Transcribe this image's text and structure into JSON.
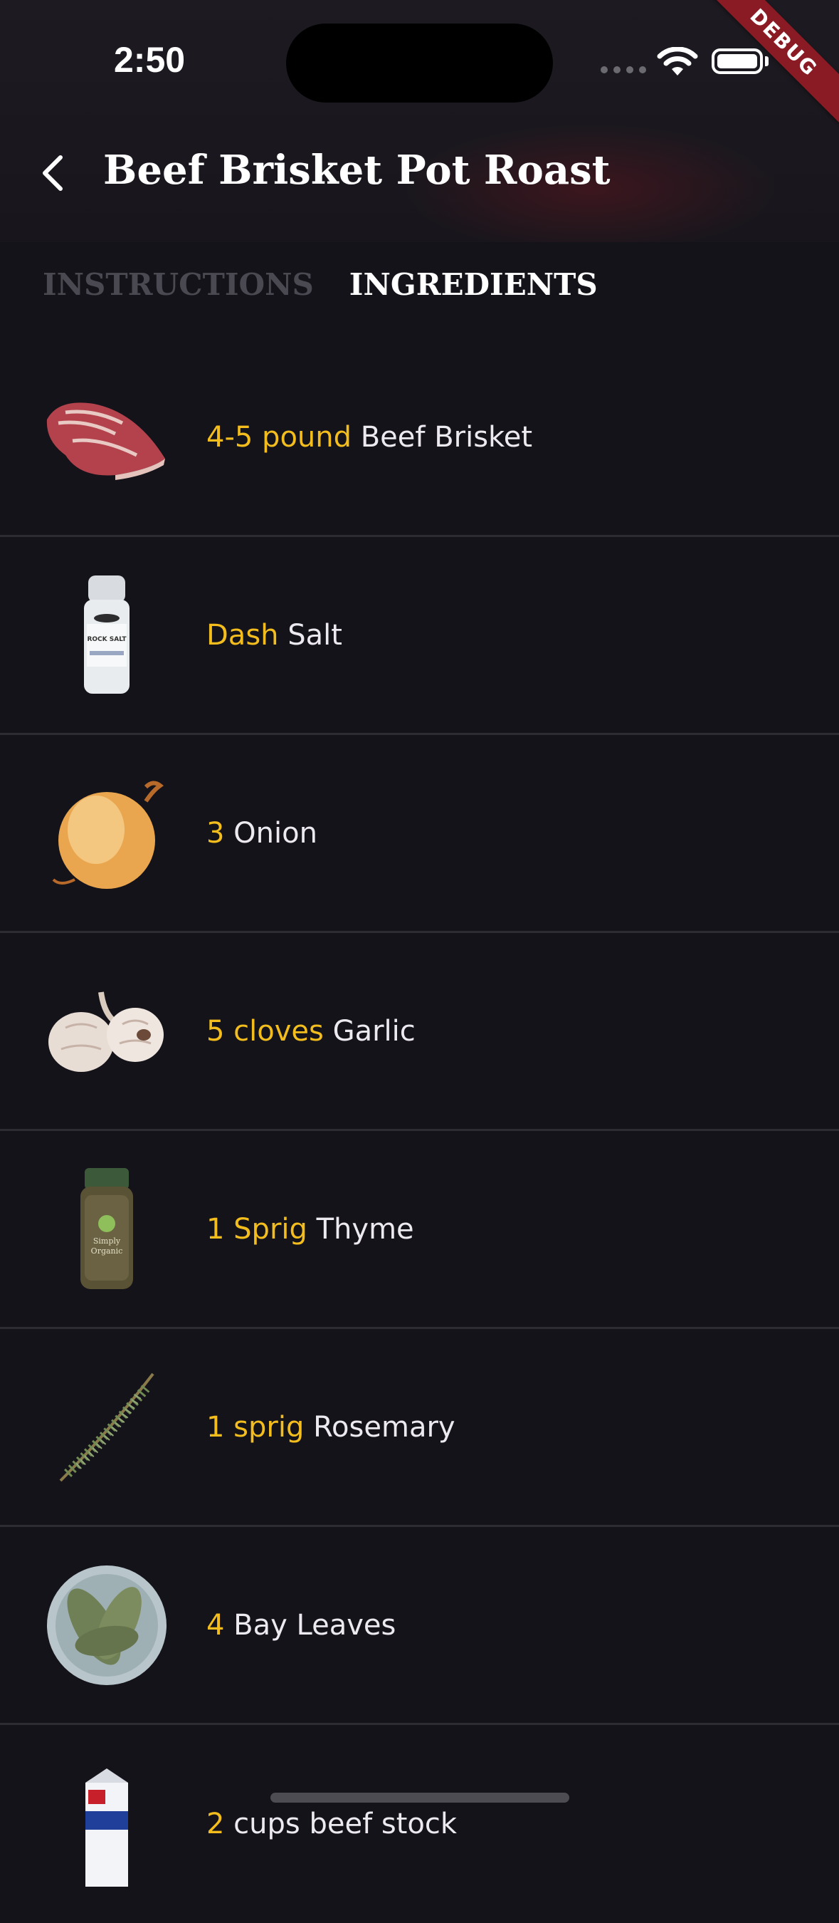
{
  "status_bar": {
    "time": "2:50",
    "debug_label": "DEBUG"
  },
  "header": {
    "title": "Beef Brisket Pot Roast"
  },
  "tabs": [
    {
      "label": "INSTRUCTIONS",
      "active": false
    },
    {
      "label": "INGREDIENTS",
      "active": true
    }
  ],
  "ingredients": [
    {
      "quantity": "4-5 pound",
      "name": "Beef Brisket",
      "icon": "brisket-image"
    },
    {
      "quantity": "Dash",
      "name": "Salt",
      "icon": "salt-grinder-image",
      "jar_label": "ROCK SALT"
    },
    {
      "quantity": "3",
      "name": "Onion",
      "icon": "onion-image"
    },
    {
      "quantity": "5 cloves",
      "name": "Garlic",
      "icon": "garlic-image"
    },
    {
      "quantity": "1 Sprig",
      "name": "Thyme",
      "icon": "thyme-jar-image"
    },
    {
      "quantity": "1 sprig",
      "name": "Rosemary",
      "icon": "rosemary-image"
    },
    {
      "quantity": "4",
      "name": "Bay Leaves",
      "icon": "bay-leaves-image"
    },
    {
      "quantity": "2",
      "name": "cups beef stock",
      "icon": "beef-stock-carton-image"
    }
  ],
  "colors": {
    "background": "#15131a",
    "quantity": "#f2bd1d",
    "ingredient_name": "#ece9ef",
    "divider": "#2e2c33",
    "debug_ribbon": "#8a1b24"
  }
}
